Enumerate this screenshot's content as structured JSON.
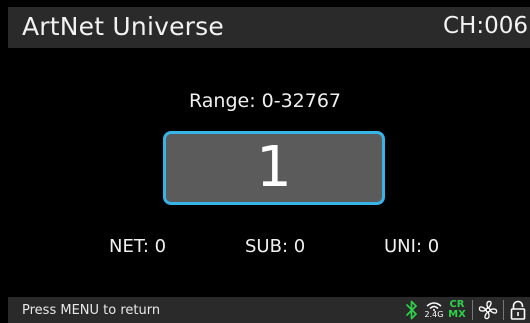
{
  "header": {
    "title": "ArtNet Universe",
    "channel": "CH:006"
  },
  "main": {
    "range_label": "Range: 0-32767",
    "value": "1",
    "net": "NET: 0",
    "sub": "SUB: 0",
    "uni": "UNI: 0"
  },
  "footer": {
    "hint": "Press MENU to return",
    "wifi_band": "2.4G",
    "crmx_top": "CR",
    "crmx_bottom": "MX",
    "icons": [
      "bluetooth-icon",
      "wifi-icon",
      "crmx-icon",
      "fan-icon",
      "unlock-icon"
    ]
  },
  "colors": {
    "accent": "#39b2e6",
    "status_green": "#2fd04a",
    "bar_bg": "#2a2a2a",
    "value_bg": "#5b5b5b"
  }
}
